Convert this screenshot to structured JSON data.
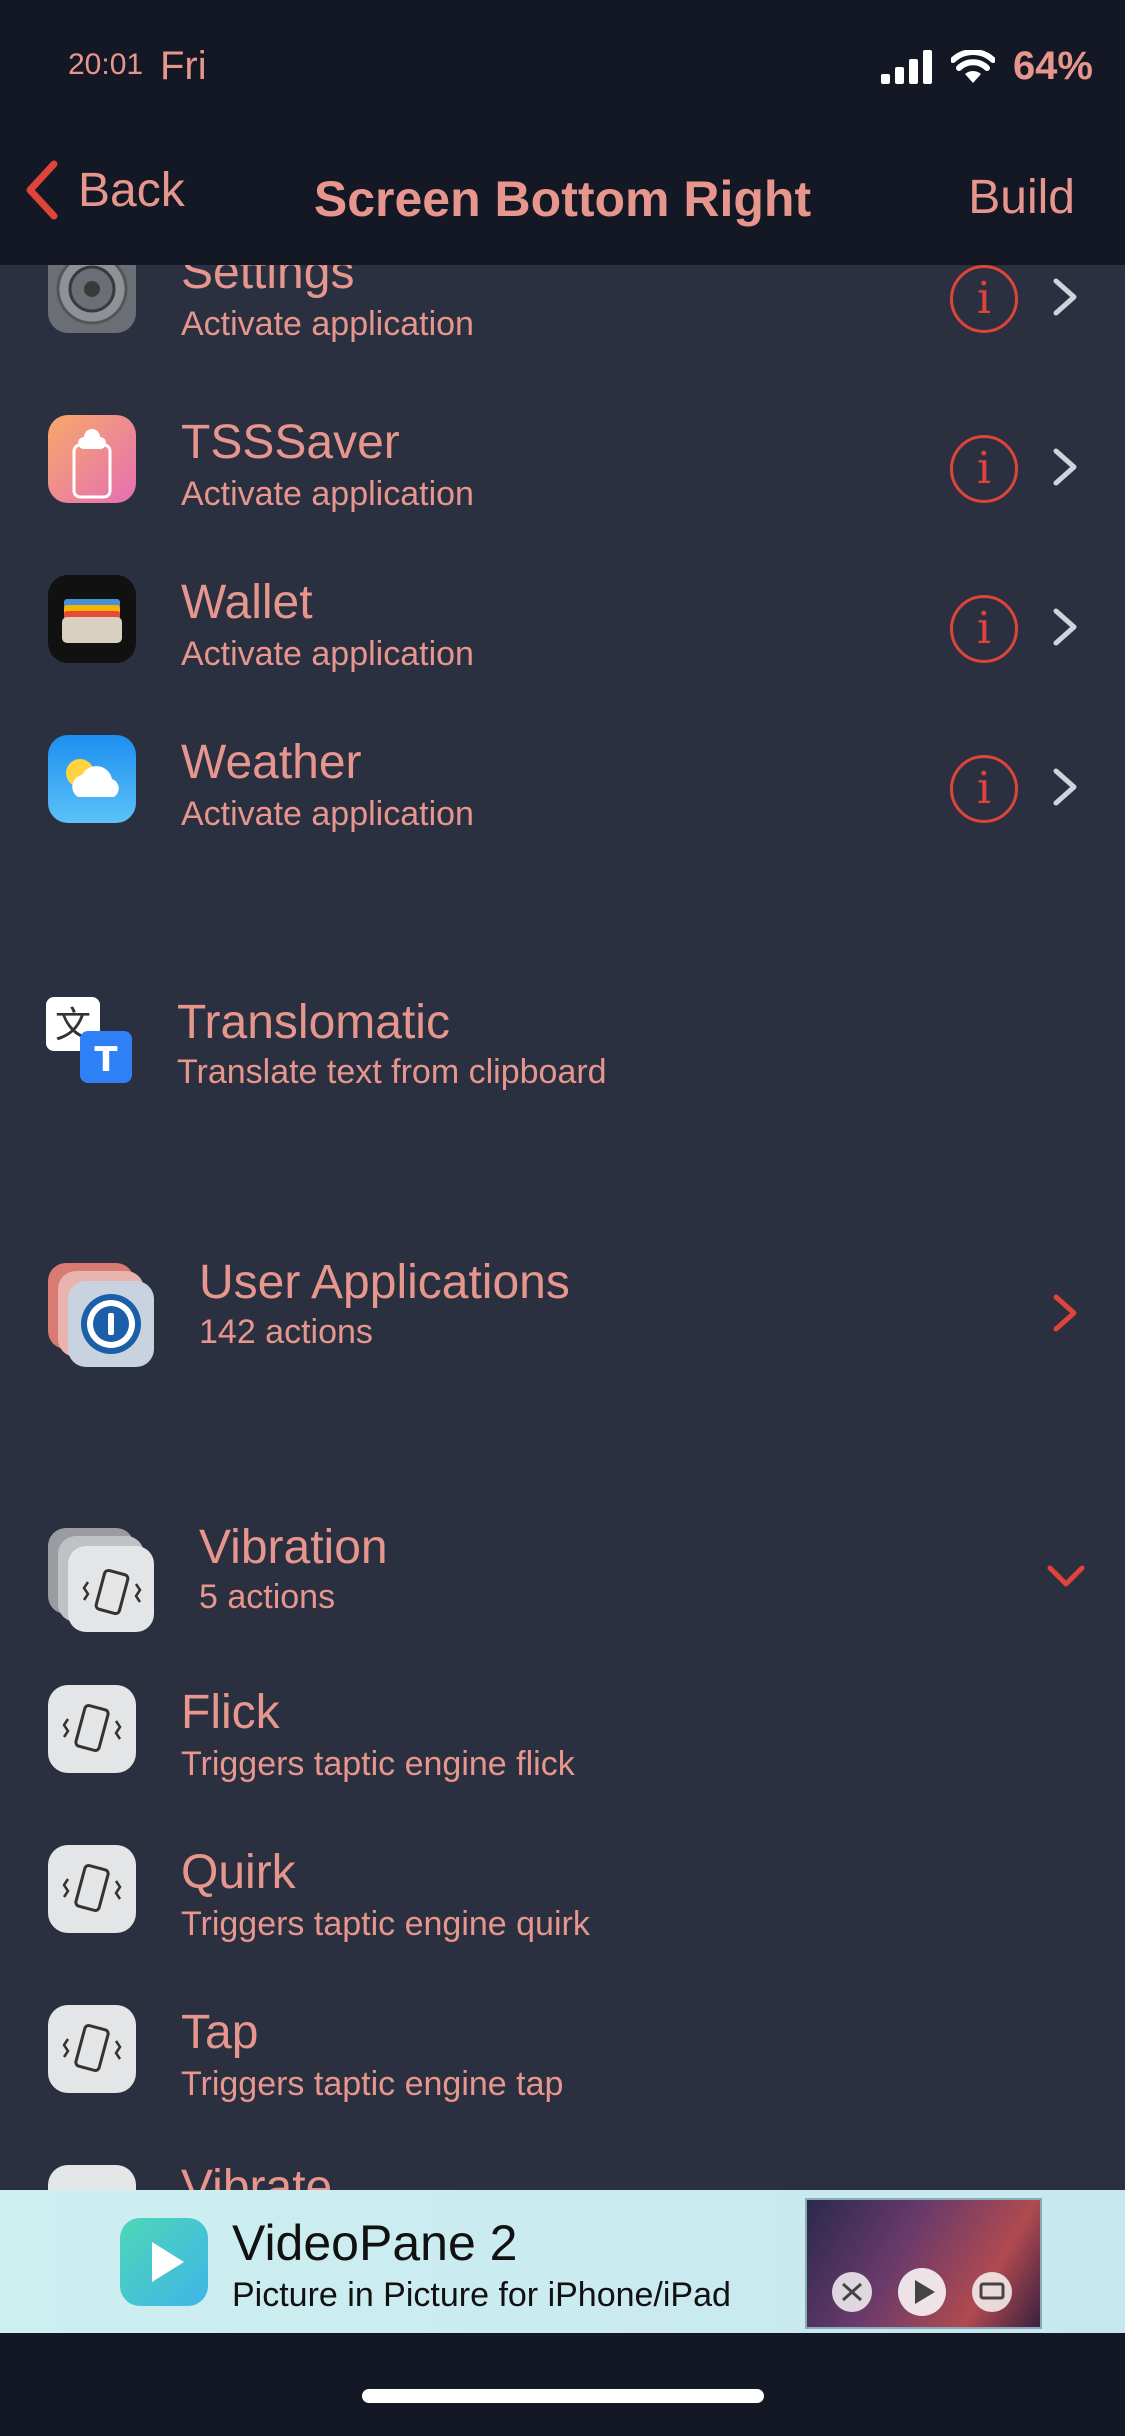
{
  "status": {
    "time": "20:01",
    "day": "Fri",
    "battery": "64%"
  },
  "nav": {
    "back": "Back",
    "title": "Screen Bottom Right",
    "build": "Build"
  },
  "apps": [
    {
      "title": "Settings",
      "subtitle": "Activate application",
      "icon": "settings-gear-icon"
    },
    {
      "title": "TSSSaver",
      "subtitle": "Activate application",
      "icon": "tsssaver-icon"
    },
    {
      "title": "Wallet",
      "subtitle": "Activate application",
      "icon": "wallet-icon"
    },
    {
      "title": "Weather",
      "subtitle": "Activate application",
      "icon": "weather-icon"
    }
  ],
  "translomatic": {
    "title": "Translomatic",
    "subtitle": "Translate text from clipboard"
  },
  "user_apps": {
    "title": "User Applications",
    "subtitle": "142 actions"
  },
  "vibration": {
    "title": "Vibration",
    "subtitle": "5 actions"
  },
  "vibration_items": [
    {
      "title": "Flick",
      "subtitle": "Triggers taptic engine flick"
    },
    {
      "title": "Quirk",
      "subtitle": "Triggers taptic engine quirk"
    },
    {
      "title": "Tap",
      "subtitle": "Triggers taptic engine tap"
    },
    {
      "title": "Vibrate"
    }
  ],
  "ad": {
    "title": "VideoPane 2",
    "subtitle": "Picture in Picture for iPhone/iPad"
  },
  "colors": {
    "accent": "#e0433a",
    "text": "#e6968c",
    "background": "#2a3040",
    "bar": "#141824"
  }
}
